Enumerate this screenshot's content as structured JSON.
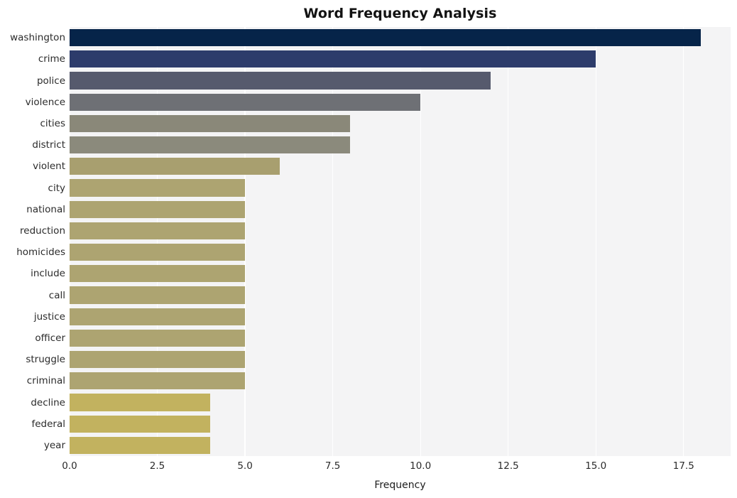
{
  "chart_data": {
    "type": "bar",
    "orientation": "horizontal",
    "title": "Word Frequency Analysis",
    "xlabel": "Frequency",
    "ylabel": "",
    "categories": [
      "washington",
      "crime",
      "police",
      "violence",
      "cities",
      "district",
      "violent",
      "city",
      "national",
      "reduction",
      "homicides",
      "include",
      "call",
      "justice",
      "officer",
      "struggle",
      "criminal",
      "decline",
      "federal",
      "year"
    ],
    "values": [
      18,
      15,
      12,
      10,
      8,
      8,
      6,
      5,
      5,
      5,
      5,
      5,
      5,
      5,
      5,
      5,
      5,
      4,
      4,
      4
    ],
    "bar_colors": [
      "#062449",
      "#2d3c6b",
      "#565a6d",
      "#6e7075",
      "#8a8879",
      "#8b8a7c",
      "#a89f6f",
      "#ada471",
      "#ada471",
      "#ada471",
      "#ada471",
      "#ada471",
      "#ada471",
      "#ada471",
      "#ada471",
      "#ada471",
      "#ada471",
      "#c2b25f",
      "#c2b25f",
      "#c2b25f"
    ],
    "xlim": [
      0,
      18.84
    ],
    "ylim": [
      -0.5,
      19.5
    ],
    "xticks": [
      0,
      2.5,
      5,
      7.5,
      10,
      12.5,
      15,
      17.5
    ],
    "xticklabels": [
      "0.0",
      "2.5",
      "5.0",
      "7.5",
      "10.0",
      "12.5",
      "15.0",
      "17.5"
    ],
    "grid": true,
    "grid_axis": "x",
    "grid_color": "#ffffff",
    "legend": false,
    "plot_bgcolor": "#f4f4f5",
    "figure_bgcolor": "#ffffff"
  }
}
